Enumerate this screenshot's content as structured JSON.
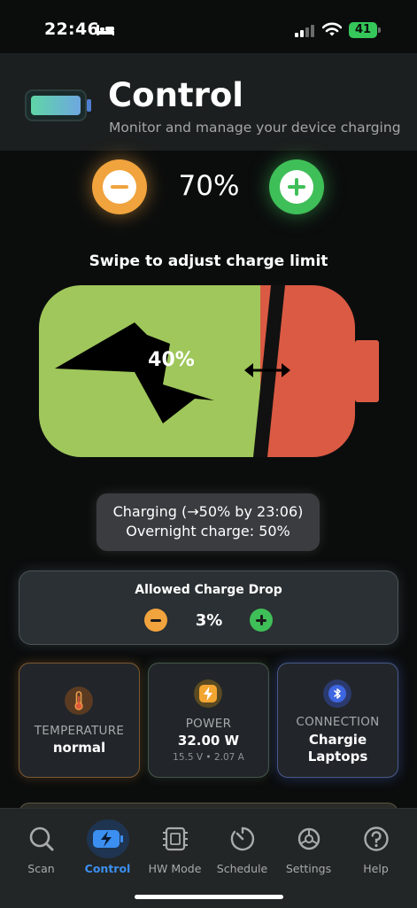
{
  "status_bar": {
    "time": "22:46",
    "battery_level": "41"
  },
  "header": {
    "title": "Control",
    "subtitle": "Monitor and manage your device charging"
  },
  "charge_limit": {
    "value": "70%",
    "hint": "Swipe to adjust charge limit"
  },
  "battery_visual": {
    "current_level_label": "40%",
    "current_level_fraction": 0.4,
    "limit_fraction": 0.7,
    "fill_color": "#9fc75b",
    "remaining_color": "#db5a43"
  },
  "charging_info": {
    "line1": "Charging (→50% by 23:06)",
    "line2": "Overnight charge: 50%"
  },
  "allowed_drop": {
    "title": "Allowed Charge Drop",
    "value": "3%"
  },
  "stats": {
    "temperature": {
      "label": "TEMPERATURE",
      "value": "normal",
      "icon": "thermometer-icon"
    },
    "power": {
      "label": "POWER",
      "value": "32.00 W",
      "sub": "15.5 V • 2.07 A",
      "icon": "bolt-icon"
    },
    "connection": {
      "label": "CONNECTION",
      "value_line1": "Chargie",
      "value_line2": "Laptops",
      "icon": "bluetooth-icon"
    }
  },
  "tabs": [
    {
      "label": "Scan",
      "icon": "search-icon"
    },
    {
      "label": "Control",
      "icon": "battery-bolt-icon",
      "active": true
    },
    {
      "label": "HW Mode",
      "icon": "chip-icon"
    },
    {
      "label": "Schedule",
      "icon": "timer-icon"
    },
    {
      "label": "Settings",
      "icon": "gear-icon"
    },
    {
      "label": "Help",
      "icon": "help-icon"
    }
  ],
  "colors": {
    "accent": "#3b8ff0",
    "minus": "#f1a33d",
    "plus": "#3fbf58"
  }
}
